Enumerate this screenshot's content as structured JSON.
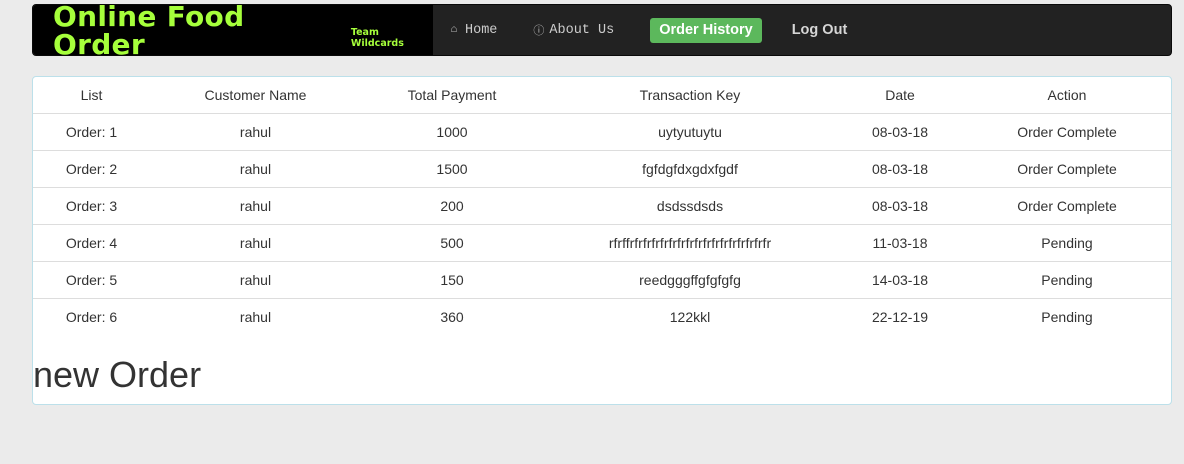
{
  "header": {
    "brand_title": "Online Food Order",
    "brand_subtitle": "Team Wildcards",
    "nav": {
      "home_label": "Home",
      "home_icon": "home-icon",
      "about_label": "About Us",
      "about_icon": "info-icon",
      "history_label": "Order History",
      "logout_label": "Log Out"
    },
    "colors": {
      "brand": "#a6ff3b",
      "active_button": "#5cb85c",
      "navbar": "#222222"
    }
  },
  "orders": {
    "columns": [
      "List",
      "Customer Name",
      "Total Payment",
      "Transaction Key",
      "Date",
      "Action"
    ],
    "rows": [
      {
        "list": "Order: 1",
        "customer": "rahul",
        "payment": "1000",
        "key": "uytyutuytu",
        "date": "08-03-18",
        "action": "Order Complete"
      },
      {
        "list": "Order: 2",
        "customer": "rahul",
        "payment": "1500",
        "key": "fgfdgfdxgdxfgdf",
        "date": "08-03-18",
        "action": "Order Complete"
      },
      {
        "list": "Order: 3",
        "customer": "rahul",
        "payment": "200",
        "key": "dsdssdsds",
        "date": "08-03-18",
        "action": "Order Complete"
      },
      {
        "list": "Order: 4",
        "customer": "rahul",
        "payment": "500",
        "key": "rfrffrfrfrfrfrfrfrfrfrfrfrfrfrfrfrfrfr",
        "date": "11-03-18",
        "action": "Pending"
      },
      {
        "list": "Order: 5",
        "customer": "rahul",
        "payment": "150",
        "key": "reedgggffgfgfgfg",
        "date": "14-03-18",
        "action": "Pending"
      },
      {
        "list": "Order: 6",
        "customer": "rahul",
        "payment": "360",
        "key": "122kkl",
        "date": "22-12-19",
        "action": "Pending"
      }
    ]
  },
  "new_order_heading": "new Order"
}
